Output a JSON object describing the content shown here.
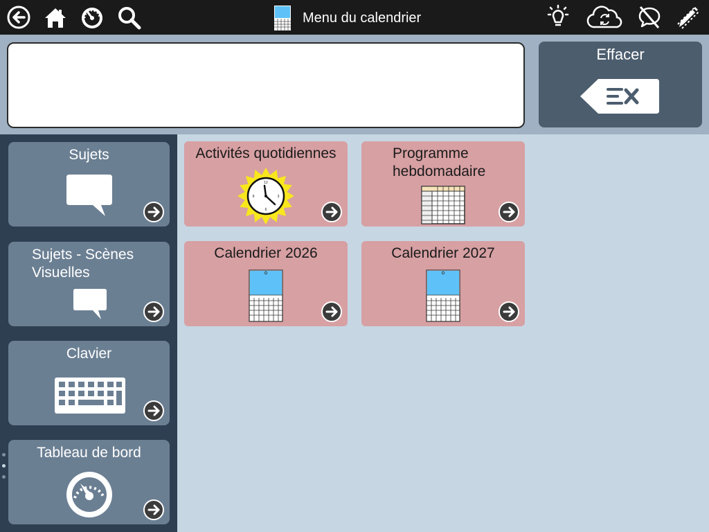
{
  "header": {
    "title": "Menu du calendrier",
    "left_icons": [
      "back-arrow-icon",
      "home-icon",
      "dashboard-gauge-icon",
      "search-icon"
    ],
    "right_icons": [
      "lightbulb-icon",
      "cloud-sync-icon",
      "speech-off-icon",
      "edit-pencil-icon"
    ]
  },
  "message_bar": {
    "text": "",
    "clear_label": "Effacer",
    "clear_icon": "clear-text-x-icon"
  },
  "sidebar": {
    "items": [
      {
        "label": "Sujets",
        "icon": "speech-bubble-icon"
      },
      {
        "label": "Sujets - Scènes Visuelles",
        "icon": "speech-bubble-small-icon"
      },
      {
        "label": "Clavier",
        "icon": "keyboard-icon"
      },
      {
        "label": "Tableau de bord",
        "icon": "dashboard-gauge-icon"
      }
    ],
    "page_count": 3,
    "active_page": 2
  },
  "grid": {
    "tiles": [
      {
        "label": "Activités quotidiennes",
        "icon": "sun-clock-icon"
      },
      {
        "label": "Programme hebdomadaire",
        "icon": "weekly-table-icon"
      },
      {
        "label": "Calendrier 2026",
        "icon": "calendar-icon"
      },
      {
        "label": "Calendrier 2027",
        "icon": "calendar-icon"
      }
    ]
  },
  "colors": {
    "topbar": "#1a1a1a",
    "message_area": "#9fb1c2",
    "sidebar": "#2d3f51",
    "sidebar_button": "#6b7f93",
    "tile": "#d7a0a3",
    "content_bg": "#c6d6e3",
    "clear_button": "#4c5d6e"
  }
}
